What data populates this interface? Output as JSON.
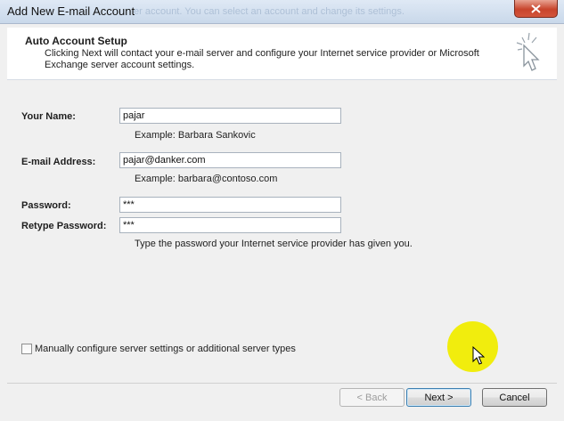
{
  "window": {
    "title": "Add New E-mail Account",
    "background_text": "er account. You can select an account and change its settings."
  },
  "header": {
    "title": "Auto Account Setup",
    "description": "Clicking Next will contact your e-mail server and configure your Internet service provider or Microsoft Exchange server account settings."
  },
  "form": {
    "name_label": "Your Name:",
    "name_value": "pajar",
    "name_example": "Example: Barbara Sankovic",
    "email_label": "E-mail Address:",
    "email_value": "pajar@danker.com",
    "email_example": "Example: barbara@contoso.com",
    "password_label": "Password:",
    "password_value": "***",
    "retype_label": "Retype Password:",
    "retype_value": "***",
    "password_hint": "Type the password your Internet service provider has given you."
  },
  "manual_config": {
    "label": "Manually configure server settings or additional server types",
    "checked": false
  },
  "buttons": {
    "back": "< Back",
    "next": "Next >",
    "cancel": "Cancel"
  },
  "colors": {
    "close_button": "#c8442c",
    "cursor_highlight": "#f0ec00"
  }
}
